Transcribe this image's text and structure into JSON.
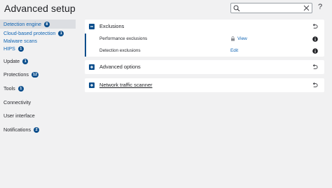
{
  "header": {
    "title": "Advanced setup",
    "search_placeholder": "",
    "help_label": "?"
  },
  "sidebar": {
    "items": [
      {
        "label": "Detection engine",
        "badge": "8"
      },
      {
        "label": "Cloud-based protection",
        "badge": "1"
      },
      {
        "label": "Malware scans",
        "badge": ""
      },
      {
        "label": "HIPS",
        "badge": "1"
      },
      {
        "label": "Update",
        "badge": "1"
      },
      {
        "label": "Protections",
        "badge": "12"
      },
      {
        "label": "Tools",
        "badge": "1"
      },
      {
        "label": "Connectivity",
        "badge": ""
      },
      {
        "label": "User interface",
        "badge": ""
      },
      {
        "label": "Notifications",
        "badge": "2"
      }
    ]
  },
  "main": {
    "exclusions": {
      "title": "Exclusions",
      "rows": [
        {
          "label": "Performance exclusions",
          "action": "View"
        },
        {
          "label": "Detection exclusions",
          "action": "Edit"
        }
      ]
    },
    "advanced_options": {
      "title": "Advanced options"
    },
    "network_traffic_scanner": {
      "title": "Network traffic scanner"
    }
  },
  "colors": {
    "accent": "#0b4e8c",
    "link": "#1065b4",
    "background": "#f1f1f2"
  }
}
